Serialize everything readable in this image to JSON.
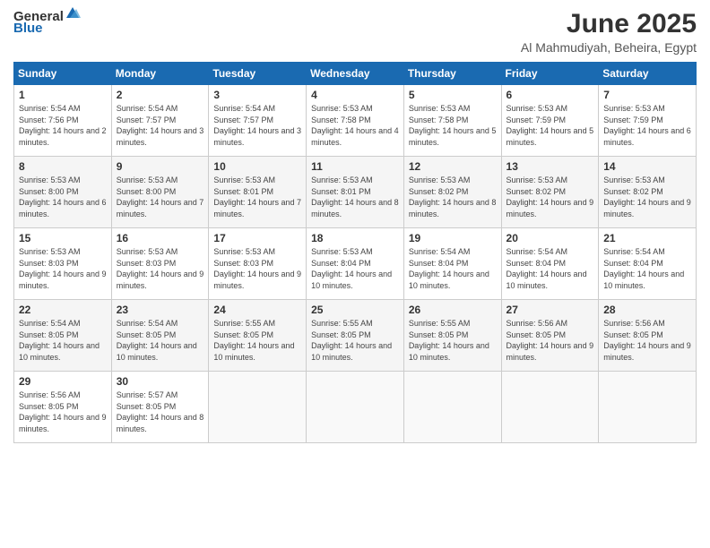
{
  "logo": {
    "general": "General",
    "blue": "Blue"
  },
  "title": "June 2025",
  "subtitle": "Al Mahmudiyah, Beheira, Egypt",
  "weekdays": [
    "Sunday",
    "Monday",
    "Tuesday",
    "Wednesday",
    "Thursday",
    "Friday",
    "Saturday"
  ],
  "weeks": [
    [
      {
        "day": "1",
        "sunrise": "5:54 AM",
        "sunset": "7:56 PM",
        "daylight": "14 hours and 2 minutes."
      },
      {
        "day": "2",
        "sunrise": "5:54 AM",
        "sunset": "7:57 PM",
        "daylight": "14 hours and 3 minutes."
      },
      {
        "day": "3",
        "sunrise": "5:54 AM",
        "sunset": "7:57 PM",
        "daylight": "14 hours and 3 minutes."
      },
      {
        "day": "4",
        "sunrise": "5:53 AM",
        "sunset": "7:58 PM",
        "daylight": "14 hours and 4 minutes."
      },
      {
        "day": "5",
        "sunrise": "5:53 AM",
        "sunset": "7:58 PM",
        "daylight": "14 hours and 5 minutes."
      },
      {
        "day": "6",
        "sunrise": "5:53 AM",
        "sunset": "7:59 PM",
        "daylight": "14 hours and 5 minutes."
      },
      {
        "day": "7",
        "sunrise": "5:53 AM",
        "sunset": "7:59 PM",
        "daylight": "14 hours and 6 minutes."
      }
    ],
    [
      {
        "day": "8",
        "sunrise": "5:53 AM",
        "sunset": "8:00 PM",
        "daylight": "14 hours and 6 minutes."
      },
      {
        "day": "9",
        "sunrise": "5:53 AM",
        "sunset": "8:00 PM",
        "daylight": "14 hours and 7 minutes."
      },
      {
        "day": "10",
        "sunrise": "5:53 AM",
        "sunset": "8:01 PM",
        "daylight": "14 hours and 7 minutes."
      },
      {
        "day": "11",
        "sunrise": "5:53 AM",
        "sunset": "8:01 PM",
        "daylight": "14 hours and 8 minutes."
      },
      {
        "day": "12",
        "sunrise": "5:53 AM",
        "sunset": "8:02 PM",
        "daylight": "14 hours and 8 minutes."
      },
      {
        "day": "13",
        "sunrise": "5:53 AM",
        "sunset": "8:02 PM",
        "daylight": "14 hours and 9 minutes."
      },
      {
        "day": "14",
        "sunrise": "5:53 AM",
        "sunset": "8:02 PM",
        "daylight": "14 hours and 9 minutes."
      }
    ],
    [
      {
        "day": "15",
        "sunrise": "5:53 AM",
        "sunset": "8:03 PM",
        "daylight": "14 hours and 9 minutes."
      },
      {
        "day": "16",
        "sunrise": "5:53 AM",
        "sunset": "8:03 PM",
        "daylight": "14 hours and 9 minutes."
      },
      {
        "day": "17",
        "sunrise": "5:53 AM",
        "sunset": "8:03 PM",
        "daylight": "14 hours and 9 minutes."
      },
      {
        "day": "18",
        "sunrise": "5:53 AM",
        "sunset": "8:04 PM",
        "daylight": "14 hours and 10 minutes."
      },
      {
        "day": "19",
        "sunrise": "5:54 AM",
        "sunset": "8:04 PM",
        "daylight": "14 hours and 10 minutes."
      },
      {
        "day": "20",
        "sunrise": "5:54 AM",
        "sunset": "8:04 PM",
        "daylight": "14 hours and 10 minutes."
      },
      {
        "day": "21",
        "sunrise": "5:54 AM",
        "sunset": "8:04 PM",
        "daylight": "14 hours and 10 minutes."
      }
    ],
    [
      {
        "day": "22",
        "sunrise": "5:54 AM",
        "sunset": "8:05 PM",
        "daylight": "14 hours and 10 minutes."
      },
      {
        "day": "23",
        "sunrise": "5:54 AM",
        "sunset": "8:05 PM",
        "daylight": "14 hours and 10 minutes."
      },
      {
        "day": "24",
        "sunrise": "5:55 AM",
        "sunset": "8:05 PM",
        "daylight": "14 hours and 10 minutes."
      },
      {
        "day": "25",
        "sunrise": "5:55 AM",
        "sunset": "8:05 PM",
        "daylight": "14 hours and 10 minutes."
      },
      {
        "day": "26",
        "sunrise": "5:55 AM",
        "sunset": "8:05 PM",
        "daylight": "14 hours and 10 minutes."
      },
      {
        "day": "27",
        "sunrise": "5:56 AM",
        "sunset": "8:05 PM",
        "daylight": "14 hours and 9 minutes."
      },
      {
        "day": "28",
        "sunrise": "5:56 AM",
        "sunset": "8:05 PM",
        "daylight": "14 hours and 9 minutes."
      }
    ],
    [
      {
        "day": "29",
        "sunrise": "5:56 AM",
        "sunset": "8:05 PM",
        "daylight": "14 hours and 9 minutes."
      },
      {
        "day": "30",
        "sunrise": "5:57 AM",
        "sunset": "8:05 PM",
        "daylight": "14 hours and 8 minutes."
      },
      null,
      null,
      null,
      null,
      null
    ]
  ]
}
